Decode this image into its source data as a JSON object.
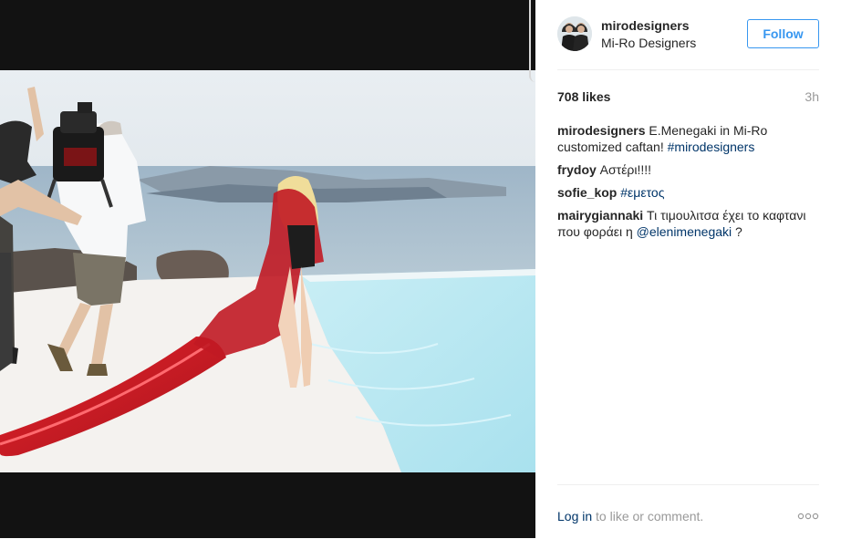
{
  "post": {
    "username": "mirodesigners",
    "full_name": "Mi-Ro Designers",
    "follow_label": "Follow",
    "likes": "708 likes",
    "time_ago": "3h"
  },
  "comments": [
    {
      "user": "mirodesigners",
      "text": " E.Menegaki in Mi-Ro customized caftan! ",
      "link": "#mirodesigners",
      "tail": ""
    },
    {
      "user": "frydoy",
      "text": " Αστέρι!!!!",
      "link": "",
      "tail": ""
    },
    {
      "user": "sofie_kop",
      "text": " ",
      "link": "#εμετος",
      "tail": ""
    },
    {
      "user": "mairygiannaki",
      "text": " Τι τιμουλιτσα έχει το καφτανι που φοράει η ",
      "link": "@elenimenegaki",
      "tail": " ?"
    }
  ],
  "footer": {
    "login_label": "Log in",
    "login_suffix": " to like or comment."
  },
  "icons": {
    "more": "ellipsis-icon"
  },
  "colors": {
    "accent": "#3897f0",
    "link": "#003569",
    "muted": "#999999",
    "media_background": "#121212"
  }
}
